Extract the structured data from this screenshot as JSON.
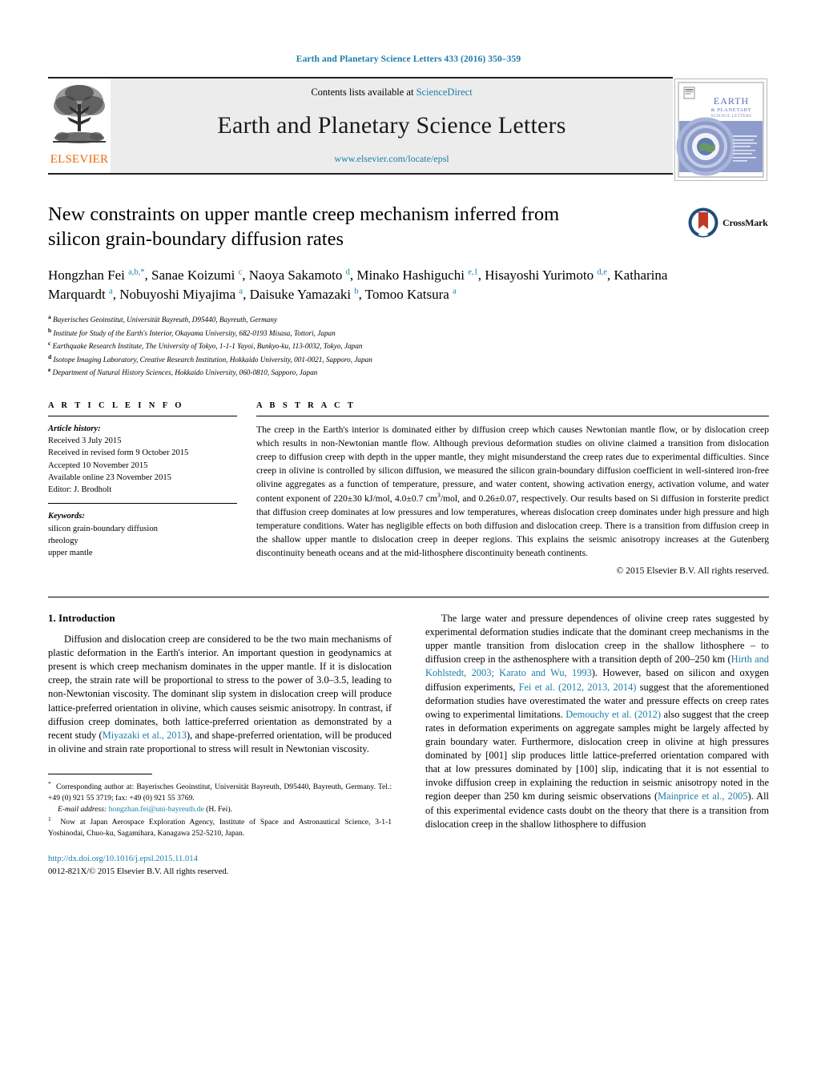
{
  "running_head": "Earth and Planetary Science Letters 433 (2016) 350–359",
  "masthead": {
    "contents_prefix": "Contents lists available at ",
    "sciencedirect": "ScienceDirect",
    "journal_name": "Earth and Planetary Science Letters",
    "journal_url": "www.elsevier.com/locate/epsl",
    "publisher_wordmark": "ELSEVIER",
    "cover_title_line1": "EARTH",
    "cover_title_line2": "& PLANETARY",
    "cover_title_line3": "SCIENCE LETTERS"
  },
  "crossmark": {
    "label": "CrossMark"
  },
  "article": {
    "title": "New constraints on upper mantle creep mechanism inferred from silicon grain-boundary diffusion rates",
    "authors_html": "Hongzhan Fei <sup>a,b,</sup><sup class=\"star\">*</sup>, Sanae Koizumi <sup>c</sup>, Naoya Sakamoto <sup>d</sup>, Minako Hashiguchi <sup>e,1</sup>, Hisayoshi Yurimoto <sup>d,e</sup>, Katharina Marquardt <sup>a</sup>, Nobuyoshi Miyajima <sup>a</sup>, Daisuke Yamazaki <sup>b</sup>, Tomoo Katsura <sup>a</sup>",
    "affiliations": [
      {
        "marker": "a",
        "text": "Bayerisches Geoinstitut, Universität Bayreuth, D95440, Bayreuth, Germany"
      },
      {
        "marker": "b",
        "text": "Institute for Study of the Earth's Interior, Okayama University, 682-0193 Misasa, Tottori, Japan"
      },
      {
        "marker": "c",
        "text": "Earthquake Research Institute, The University of Tokyo, 1-1-1 Yayoi, Bunkyo-ku, 113-0032, Tokyo, Japan"
      },
      {
        "marker": "d",
        "text": "Isotope Imaging Laboratory, Creative Research Institution, Hokkaido University, 001-0021, Sapporo, Japan"
      },
      {
        "marker": "e",
        "text": "Department of Natural History Sciences, Hokkaido University, 060-0810, Sapporo, Japan"
      }
    ]
  },
  "article_info": {
    "heading": "A R T I C L E    I N F O",
    "history_label": "Article history:",
    "history": [
      "Received 3 July 2015",
      "Received in revised form 9 October 2015",
      "Accepted 10 November 2015",
      "Available online 23 November 2015",
      "Editor: J. Brodholt"
    ],
    "keywords_label": "Keywords:",
    "keywords": [
      "silicon grain-boundary diffusion",
      "rheology",
      "upper mantle"
    ]
  },
  "abstract": {
    "heading": "A B S T R A C T",
    "text_html": "The creep in the Earth's interior is dominated either by diffusion creep which causes Newtonian mantle flow, or by dislocation creep which results in non-Newtonian mantle flow. Although previous deformation studies on olivine claimed a transition from dislocation creep to diffusion creep with depth in the upper mantle, they might misunderstand the creep rates due to experimental difficulties. Since creep in olivine is controlled by silicon diffusion, we measured the silicon grain-boundary diffusion coefficient in well-sintered iron-free olivine aggregates as a function of temperature, pressure, and water content, showing activation energy, activation volume, and water content exponent of 220±30 kJ/mol, 4.0±0.7 cm<sup>3</sup>/mol, and 0.26±0.07, respectively. Our results based on Si diffusion in forsterite predict that diffusion creep dominates at low pressures and low temperatures, whereas dislocation creep dominates under high pressure and high temperature conditions. Water has negligible effects on both diffusion and dislocation creep. There is a transition from diffusion creep in the shallow upper mantle to dislocation creep in deeper regions. This explains the seismic anisotropy increases at the Gutenberg discontinuity beneath oceans and at the mid-lithosphere discontinuity beneath continents.",
    "copyright": "© 2015 Elsevier B.V. All rights reserved."
  },
  "body": {
    "section_number_title": "1.  Introduction",
    "left_paragraph_html": "Diffusion and dislocation creep are considered to be the two main mechanisms of plastic deformation in the Earth's interior. An important question in geodynamics at present is which creep mechanism dominates in the upper mantle. If it is dislocation creep, the strain rate will be proportional to stress to the power of 3.0–3.5, leading to non-Newtonian viscosity. The dominant slip system in dislocation creep will produce lattice-preferred orientation in olivine, which causes seismic anisotropy. In contrast, if diffusion creep dominates, both lattice-preferred orientation as demonstrated by a recent study (<span class=\"ref\">Miyazaki et al., 2013</span>), and shape-preferred orientation, will be produced in olivine and strain rate proportional to stress will result in Newtonian viscosity.",
    "right_paragraph_html": "The large water and pressure dependences of olivine creep rates suggested by experimental deformation studies indicate that the dominant creep mechanisms in the upper mantle transition from dislocation creep in the shallow lithosphere – to diffusion creep in the asthenosphere with a transition depth of 200–250 km (<span class=\"ref\">Hirth and Kohlstedt, 2003; Karato and Wu, 1993</span>). However, based on silicon and oxygen diffusion experiments, <span class=\"ref\">Fei et al. (2012, 2013, 2014)</span> suggest that the aforementioned deformation studies have overestimated the water and pressure effects on creep rates owing to experimental limitations. <span class=\"ref\">Demouchy et al. (2012)</span> also suggest that the creep rates in deformation experiments on aggregate samples might be largely affected by grain boundary water. Furthermore, dislocation creep in olivine at high pressures dominated by [001] slip produces little lattice-preferred orientation compared with that at low pressures dominated by [100] slip, indicating that it is not essential to invoke diffusion creep in explaining the reduction in seismic anisotropy noted in the region deeper than 250 km during seismic observations (<span class=\"ref\">Mainprice et al., 2005</span>). All of this experimental evidence casts doubt on the theory that there is a transition from dislocation creep in the shallow lithosphere to diffusion"
  },
  "footnotes": {
    "corresponding_html": "<sup>*</sup>&nbsp; Corresponding author at: Bayerisches Geoinstitut, Universität Bayreuth, D95440, Bayreuth, Germany. Tel.: +49 (0) 921 55 3719; fax: +49 (0) 921 55 3769.",
    "email_label": "E-mail address:",
    "email": "hongzhan.fei@uni-bayreuth.de",
    "email_suffix": "(H. Fei).",
    "note1_html": "<sup>1</sup>&nbsp; Now at Japan Aerospace Exploration Agency, Institute of Space and Astronautical Science, 3-1-1 Yoshinodai, Chuo-ku, Sagamihara, Kanagawa 252-5210, Japan.",
    "doi": "http://dx.doi.org/10.1016/j.epsl.2015.11.014",
    "issn_copyright": "0012-821X/© 2015 Elsevier B.V. All rights reserved."
  },
  "colors": {
    "link_blue": "#1b7ea6",
    "elsevier_orange": "#ec6608",
    "masthead_grey": "#ececec"
  }
}
